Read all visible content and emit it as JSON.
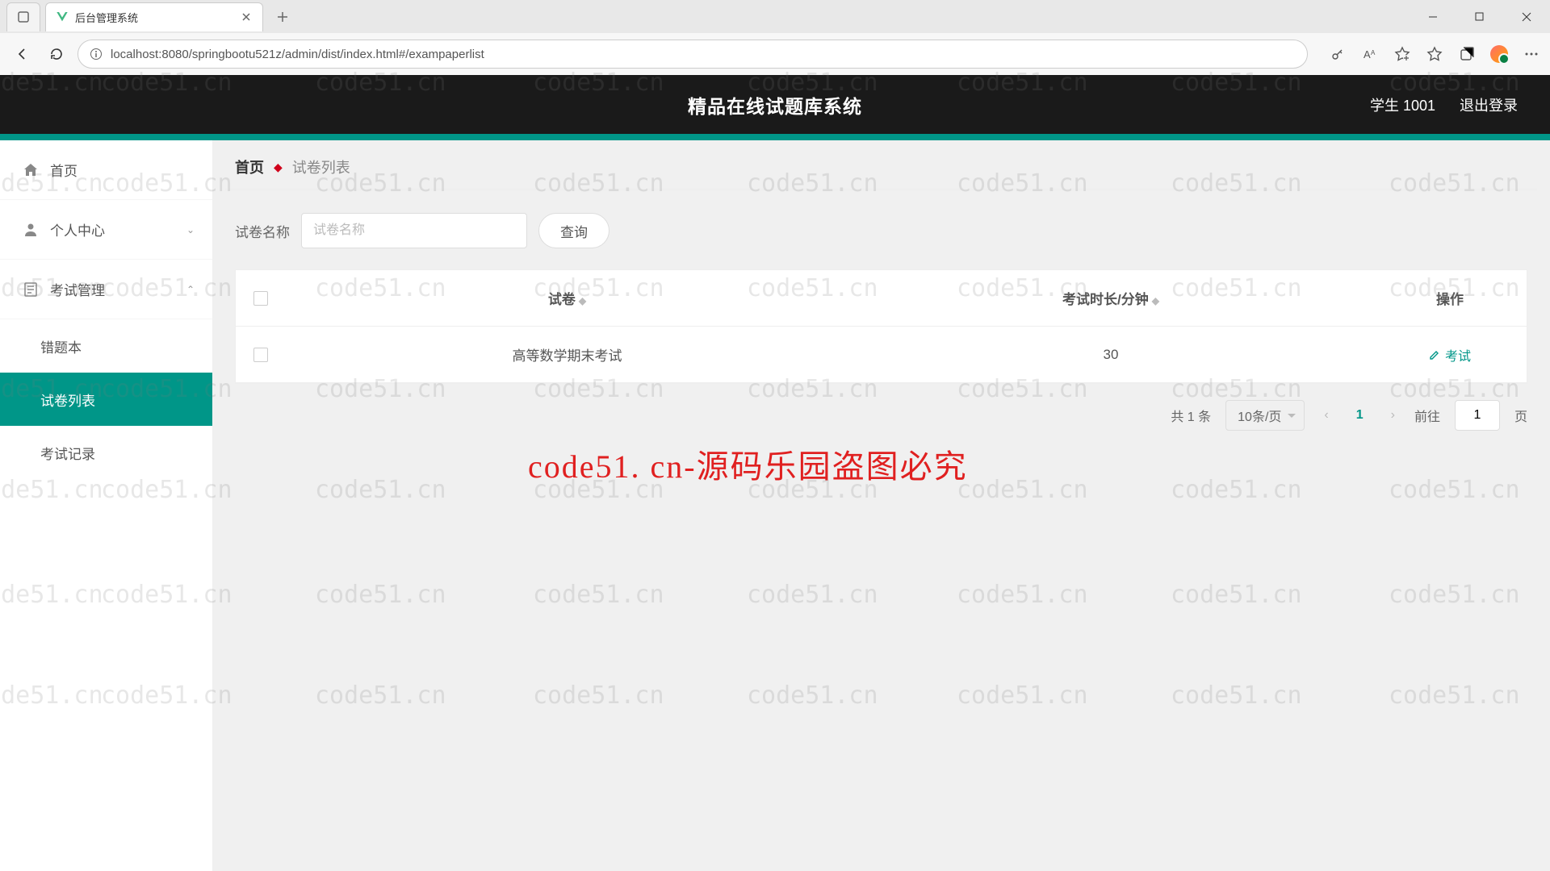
{
  "browser": {
    "tab_title": "后台管理系统",
    "url": "localhost:8080/springbootu521z/admin/dist/index.html#/exampaperlist"
  },
  "banner": {
    "title": "精品在线试题库系统",
    "user": "学生 1001",
    "logout": "退出登录"
  },
  "sidebar": {
    "home": "首页",
    "profile": "个人中心",
    "exam": "考试管理",
    "wrongbook": "错题本",
    "paperlist": "试卷列表",
    "record": "考试记录"
  },
  "crumb": {
    "home": "首页",
    "current": "试卷列表"
  },
  "search": {
    "label": "试卷名称",
    "placeholder": "试卷名称",
    "button": "查询"
  },
  "table": {
    "col_name": "试卷",
    "col_duration": "考试时长/分钟",
    "col_op": "操作",
    "row1_name": "高等数学期末考试",
    "row1_duration": "30",
    "op_exam": "考试"
  },
  "pagination": {
    "total": "共 1 条",
    "size": "10条/页",
    "current": "1",
    "goto": "前往",
    "goto_val": "1",
    "unit": "页"
  },
  "watermark": {
    "small": "code51.cn",
    "big": "code51. cn-源码乐园盗图必究"
  }
}
